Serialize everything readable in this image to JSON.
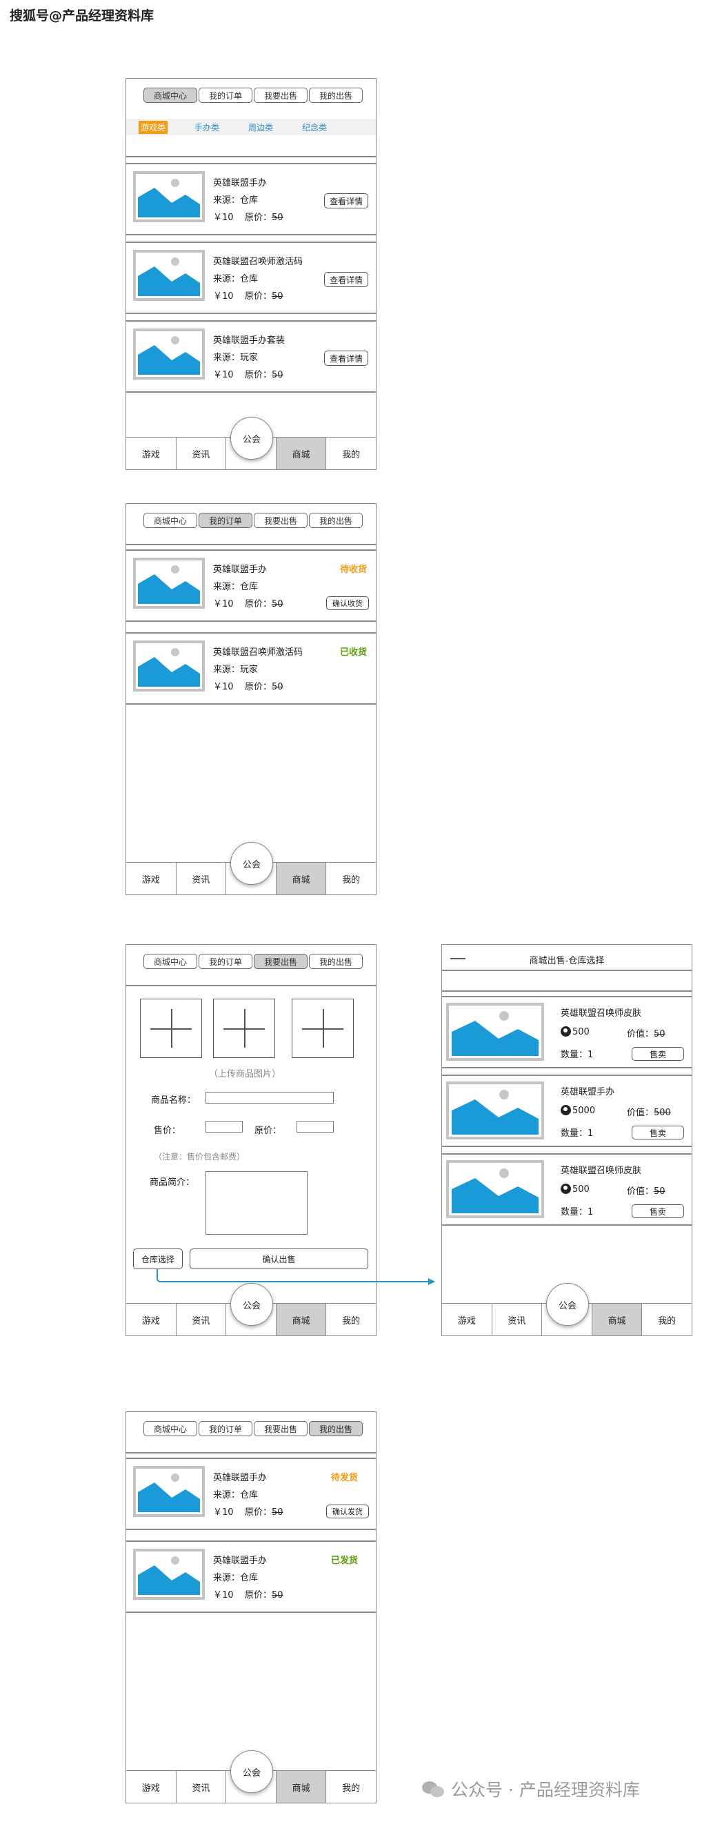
{
  "watermark_top": "搜狐号@产品经理资料库",
  "watermark_bottom": "公众号 · 产品经理资料库",
  "shop_tabs": [
    "商城中心",
    "我的订单",
    "我要出售",
    "我的出售"
  ],
  "categories": [
    "游戏类",
    "手办类",
    "周边类",
    "纪念类"
  ],
  "bottom_nav": {
    "game": "游戏",
    "news": "资讯",
    "guild": "公会",
    "mall": "商城",
    "mine": "我的"
  },
  "screen1": {
    "items": [
      {
        "name": "英雄联盟手办",
        "source": "来源：仓库",
        "price": "￥10",
        "orig_label": "原价：",
        "orig_value": "50",
        "button": "查看详情"
      },
      {
        "name": "英雄联盟召唤师激活码",
        "source": "来源：仓库",
        "price": "￥10",
        "orig_label": "原价：",
        "orig_value": "50",
        "button": "查看详情"
      },
      {
        "name": "英雄联盟手办套装",
        "source": "来源：玩家",
        "price": "￥10",
        "orig_label": "原价：",
        "orig_value": "50",
        "button": "查看详情"
      }
    ]
  },
  "screen2": {
    "items": [
      {
        "name": "英雄联盟手办",
        "source": "来源：仓库",
        "price": "￥10",
        "orig_label": "原价：",
        "orig_value": "50",
        "status": "待收货",
        "button": "确认收货"
      },
      {
        "name": "英雄联盟召唤师激活码",
        "source": "来源：玩家",
        "price": "￥10",
        "orig_label": "原价：",
        "orig_value": "50",
        "status": "已收货"
      }
    ]
  },
  "screen3": {
    "upload_hint": "（上传商品图片）",
    "name_label": "商品名称：",
    "price_label": "售价：",
    "orig_label": "原价：",
    "note": "（注意：售价包含邮费）",
    "intro_label": "商品简介：",
    "warehouse_button": "仓库选择",
    "confirm_button": "确认出售"
  },
  "screen4": {
    "title": "商城出售-仓库选择",
    "qty_label": "数量：",
    "value_label": "价值：",
    "items": [
      {
        "name": "英雄联盟召唤师皮肤",
        "coins": "500",
        "value": "50",
        "qty": "1",
        "button": "售卖"
      },
      {
        "name": "英雄联盟手办",
        "coins": "5000",
        "value": "500",
        "qty": "1",
        "button": "售卖"
      },
      {
        "name": "英雄联盟召唤师皮肤",
        "coins": "500",
        "value": "50",
        "qty": "1",
        "button": "售卖"
      }
    ]
  },
  "screen5": {
    "items": [
      {
        "name": "英雄联盟手办",
        "source": "来源：仓库",
        "price": "￥10",
        "orig_label": "原价：",
        "orig_value": "50",
        "status": "待发货",
        "button": "确认发货"
      },
      {
        "name": "英雄联盟手办",
        "source": "来源：仓库",
        "price": "￥10",
        "orig_label": "原价：",
        "orig_value": "50",
        "status": "已发货"
      }
    ]
  },
  "colors": {
    "accent_blue": "#1a9bd7",
    "tab_active": "#cfcfcf",
    "status_wait": "#f39c12",
    "status_done": "#5a9e0a",
    "arrow": "#2a93c4"
  }
}
